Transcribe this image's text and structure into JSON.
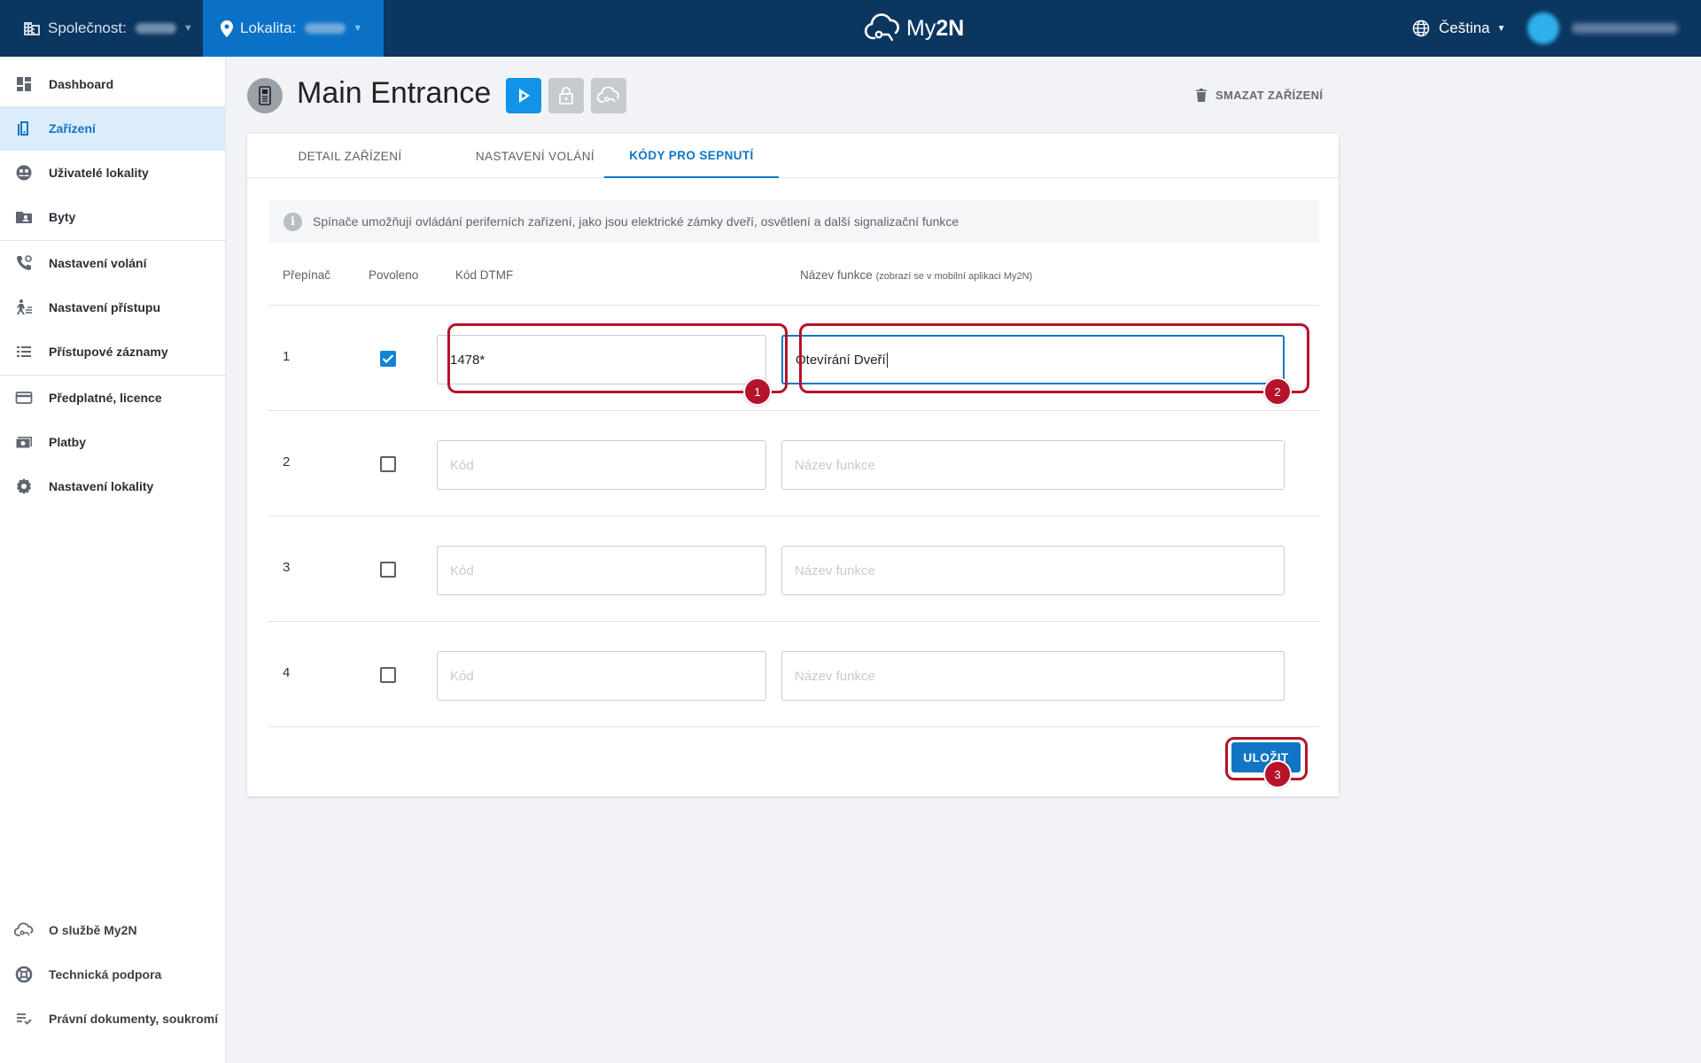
{
  "topbar": {
    "company_label": "Společnost:",
    "locality_label": "Lokalita:",
    "logo_text": "My",
    "logo_bold": "2N",
    "language": "Čeština"
  },
  "sidebar": {
    "items": [
      {
        "label": "Dashboard",
        "icon": "dashboard-icon"
      },
      {
        "label": "Zařízení",
        "icon": "device-icon",
        "active": true
      },
      {
        "label": "Uživatelé lokality",
        "icon": "users-icon"
      },
      {
        "label": "Byty",
        "icon": "apartments-icon"
      },
      {
        "label": "Nastavení volání",
        "icon": "call-settings-icon"
      },
      {
        "label": "Nastavení přístupu",
        "icon": "access-settings-icon"
      },
      {
        "label": "Přístupové záznamy",
        "icon": "access-log-icon"
      },
      {
        "label": "Předplatné, licence",
        "icon": "subscription-icon"
      },
      {
        "label": "Platby",
        "icon": "payments-icon"
      },
      {
        "label": "Nastavení lokality",
        "icon": "gear-icon"
      }
    ],
    "footer": [
      {
        "label": "O službě My2N",
        "icon": "cloud-icon"
      },
      {
        "label": "Technická podpora",
        "icon": "support-icon"
      },
      {
        "label": "Právní dokumenty, soukromí",
        "icon": "legal-icon"
      }
    ]
  },
  "header": {
    "title": "Main Entrance",
    "delete_label": "SMAZAT ZAŘÍZENÍ"
  },
  "tabs": [
    {
      "label": "DETAIL ZAŘÍZENÍ"
    },
    {
      "label": "NASTAVENÍ VOLÁNÍ"
    },
    {
      "label": "KÓDY PRO SEPNUTÍ",
      "active": true
    }
  ],
  "info_text": "Spínače umožňují ovládání periferních zařízení, jako jsou elektrické zámky dveří, osvětlení a další signalizační funkce",
  "columns": {
    "switch": "Přepínač",
    "enabled": "Povoleno",
    "code": "Kód DTMF",
    "name": "Název funkce",
    "name_note": "(zobrazí se v mobilní aplikaci My2N)"
  },
  "rows": [
    {
      "num": "1",
      "enabled": true,
      "code": "1478*",
      "name": "Otevírání Dveří"
    },
    {
      "num": "2",
      "enabled": false,
      "code": "",
      "name": ""
    },
    {
      "num": "3",
      "enabled": false,
      "code": "",
      "name": ""
    },
    {
      "num": "4",
      "enabled": false,
      "code": "",
      "name": ""
    }
  ],
  "placeholders": {
    "code": "Kód",
    "name": "Název funkce"
  },
  "save_label": "ULOŽIT",
  "markers": [
    "1",
    "2",
    "3"
  ],
  "colors": {
    "topbar": "#0b3660",
    "accent": "#1075c5",
    "highlight": "#b5132a"
  }
}
